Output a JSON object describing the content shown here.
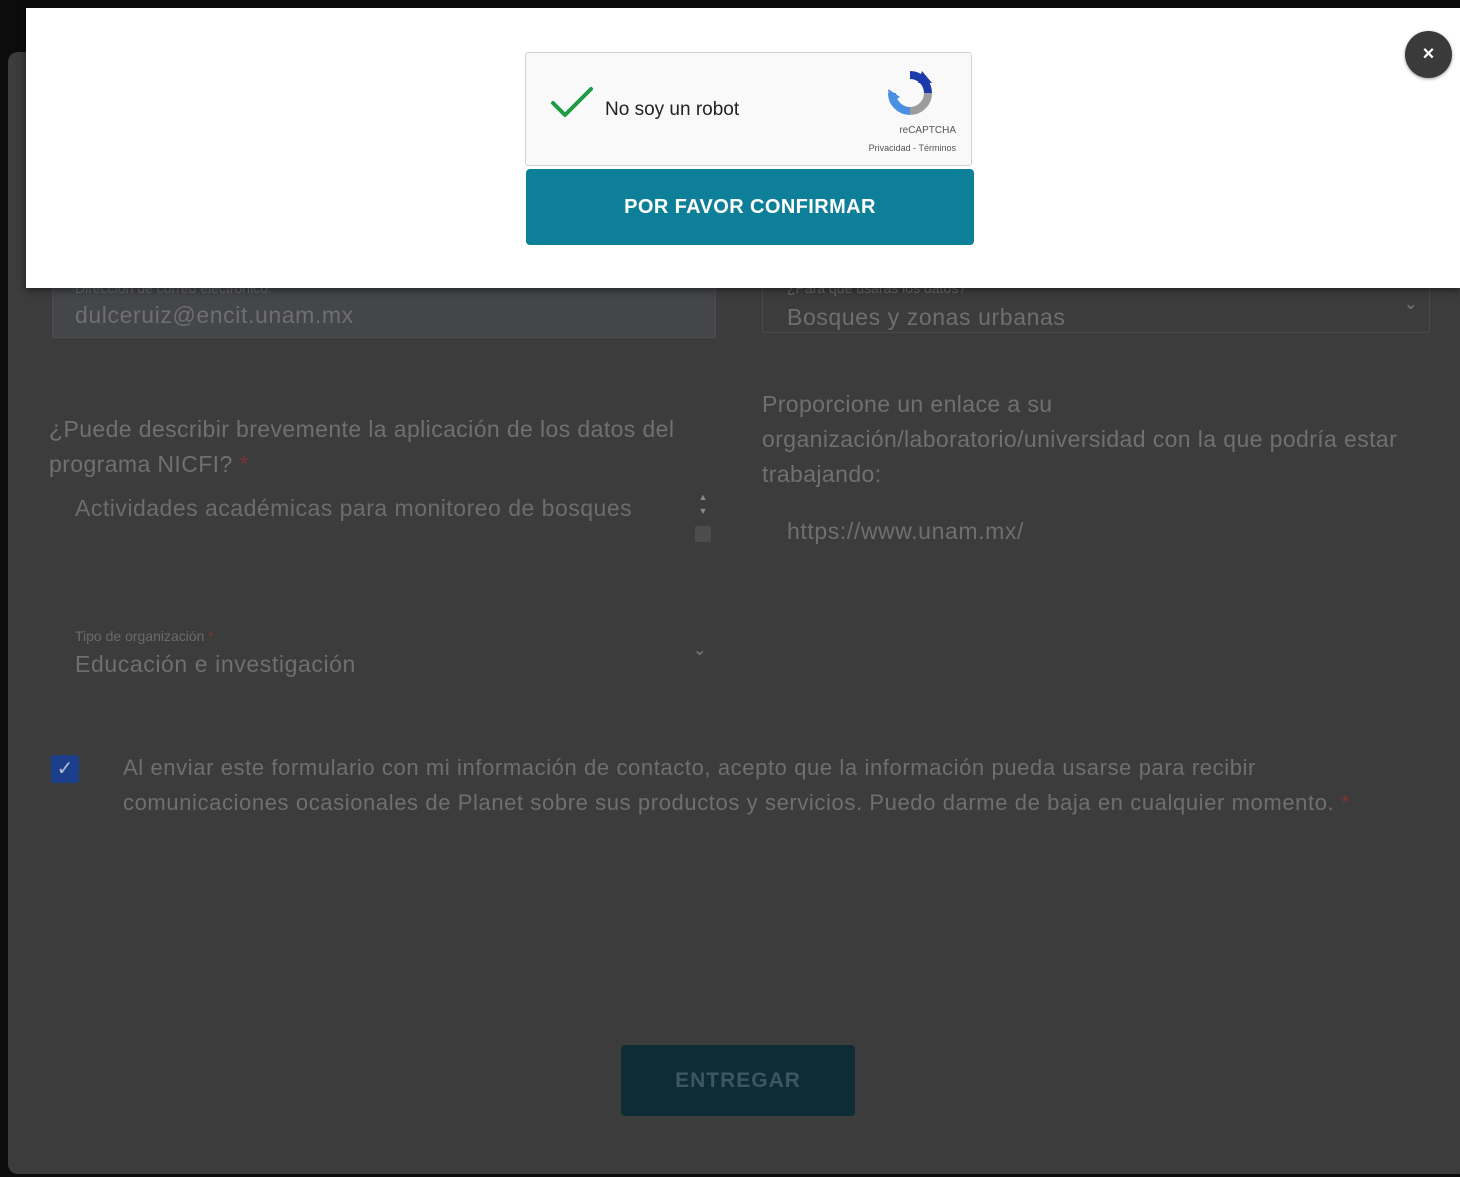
{
  "form": {
    "email": {
      "label": "Dirección de correo electrónico:",
      "value": "dulceruiz@encit.unam.mx"
    },
    "data_use": {
      "label": "¿Para qué usarás los datos?",
      "value": "Bosques y zonas urbanas"
    },
    "application": {
      "question": "¿Puede describir brevemente la aplicación de los datos del programa NICFI?",
      "required_mark": "*",
      "value": "Actividades académicas para monitoreo de bosques"
    },
    "link": {
      "question": "Proporcione un enlace a su organización/laboratorio/universidad con la que podría estar trabajando:",
      "value": "https://www.unam.mx/"
    },
    "org_type": {
      "label": "Tipo de organización",
      "required_mark": "*",
      "value": "Educación e investigación"
    },
    "consent": {
      "checked": true,
      "text": "Al enviar este formulario con mi información de contacto, acepto que la información pueda usarse para recibir comunicaciones ocasionales de Planet sobre sus productos y servicios. Puedo darme de baja en cualquier momento.",
      "required_mark": "*"
    },
    "submit_label": "ENTREGAR"
  },
  "modal": {
    "close_glyph": "×",
    "recaptcha": {
      "label": "No soy un robot",
      "brand": "reCAPTCHA",
      "links": "Privacidad - Términos",
      "verified": true
    },
    "confirm_label": "POR FAVOR CONFIRMAR"
  },
  "colors": {
    "confirm_button": "#0e7f98",
    "checkbox": "#1c3f8c",
    "check_green": "#1e9b45",
    "required": "#7a3434"
  }
}
